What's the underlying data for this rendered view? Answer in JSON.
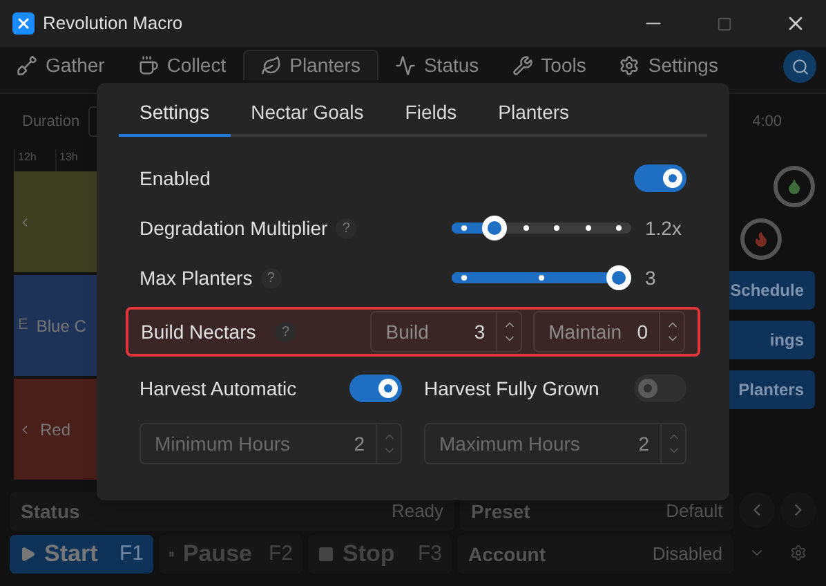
{
  "window": {
    "title": "Revolution Macro"
  },
  "nav_tabs": [
    {
      "label": "Gather",
      "selected": false
    },
    {
      "label": "Collect",
      "selected": false
    },
    {
      "label": "Planters",
      "selected": true
    },
    {
      "label": "Status",
      "selected": false
    },
    {
      "label": "Tools",
      "selected": false
    },
    {
      "label": "Settings",
      "selected": false
    }
  ],
  "toolbar": {
    "duration_label": "Duration",
    "time": "4:00"
  },
  "timeline": {
    "hours": [
      "12h",
      "13h"
    ],
    "rows": [
      {
        "color": "#3d3f21"
      },
      {
        "label": "Blue C",
        "side_label": "E",
        "color": "#1f3359"
      },
      {
        "label": "Red",
        "color": "#4a1f1a"
      }
    ]
  },
  "side_buttons": [
    "Schedule",
    "ings",
    "Planters"
  ],
  "status_bar": {
    "status_label": "Status",
    "status_value": "Ready",
    "preset_label": "Preset",
    "preset_value": "Default",
    "account_label": "Account",
    "account_value": "Disabled"
  },
  "controls": [
    {
      "kind": "play",
      "label": "Start",
      "key": "F1"
    },
    {
      "kind": "pause",
      "label": "Pause",
      "key": "F2"
    },
    {
      "kind": "stop",
      "label": "Stop",
      "key": "F3"
    }
  ],
  "dialog": {
    "tabs": [
      {
        "label": "Settings",
        "selected": true
      },
      {
        "label": "Nectar Goals",
        "selected": false
      },
      {
        "label": "Fields",
        "selected": false
      },
      {
        "label": "Planters",
        "selected": false
      }
    ],
    "rows": [
      {
        "kind": "toggle",
        "label": "Enabled",
        "on": true
      },
      {
        "kind": "slider",
        "label": "Degradation Multiplier",
        "help": "?",
        "level": 0.2,
        "reading": "1.2x"
      },
      {
        "kind": "slider",
        "label": "Max Planters",
        "help": "?",
        "level": 1,
        "reading": "3"
      },
      {
        "kind": "spinners",
        "label": "Build Nectars",
        "help": "?",
        "highlighted": true,
        "fields": [
          {
            "label": "Build",
            "value": "3"
          },
          {
            "label": "Maintain",
            "value": "0"
          }
        ]
      },
      {
        "kind": "toggle_pair",
        "items": [
          {
            "label": "Harvest Automatic",
            "on": true
          },
          {
            "label": "Harvest Fully Grown",
            "on": false
          }
        ]
      },
      {
        "kind": "spinners_plain",
        "fields": [
          {
            "label": "Minimum Hours",
            "value": "2",
            "disabled": true
          },
          {
            "label": "Maximum Hours",
            "value": "2",
            "disabled": true
          }
        ]
      }
    ]
  }
}
